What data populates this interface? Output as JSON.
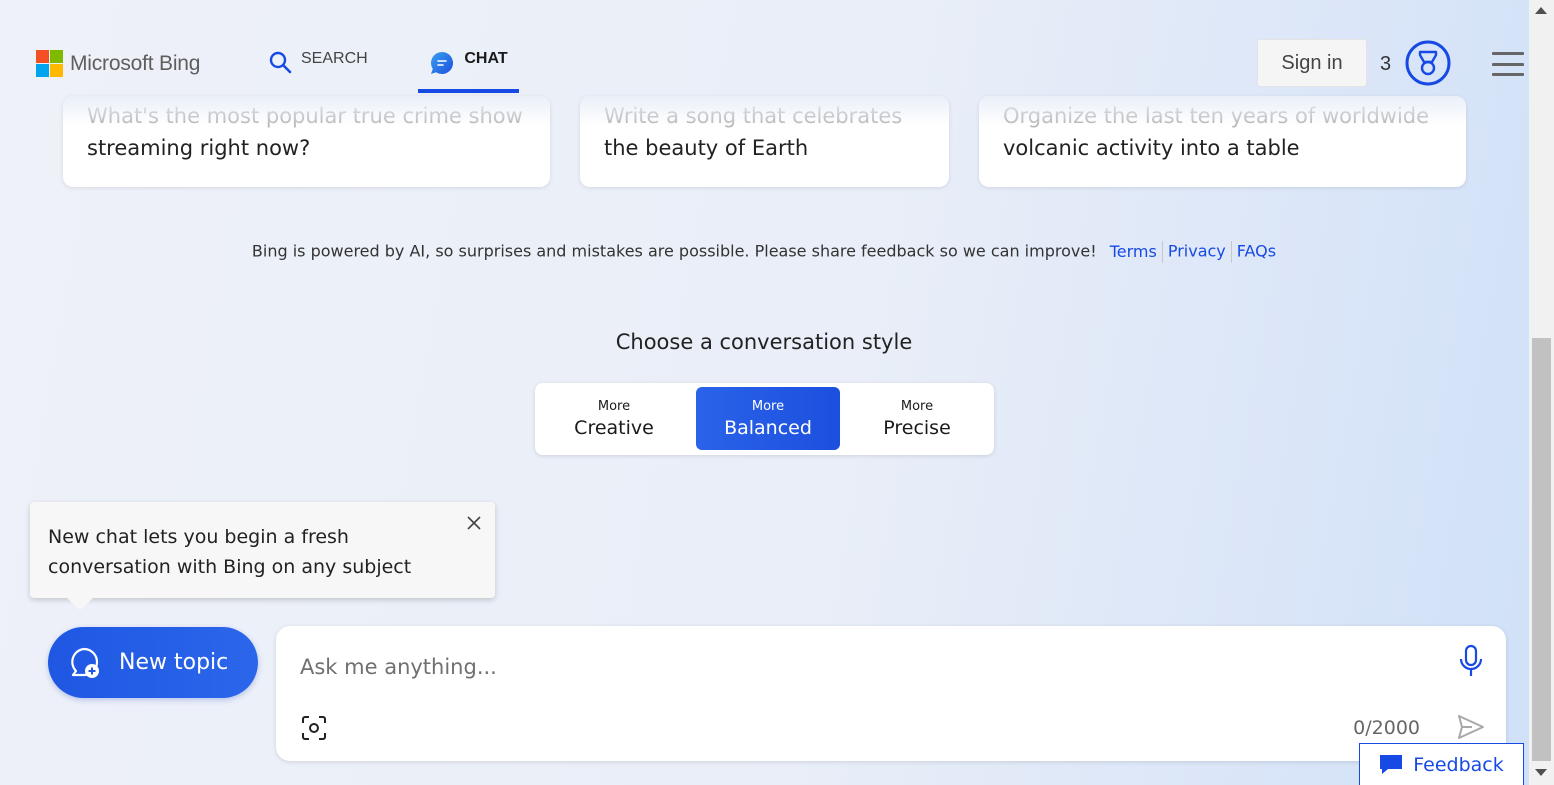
{
  "header": {
    "logo_text": "Microsoft Bing",
    "nav_search": "SEARCH",
    "nav_chat": "CHAT",
    "sign_in": "Sign in",
    "reward_count": "3",
    "accent_color": "#174ae4"
  },
  "suggestions": [
    {
      "line1": "What's the most popular true crime show",
      "line2": "streaming right now?"
    },
    {
      "line1": "Write a song that celebrates",
      "line2": "the beauty of Earth"
    },
    {
      "line1": "Organize the last ten years of worldwide",
      "line2": "volcanic activity into a table"
    }
  ],
  "disclaimer": {
    "text": "Bing is powered by AI, so surprises and mistakes are possible. Please share feedback so we can improve!",
    "links": [
      "Terms",
      "Privacy",
      "FAQs"
    ]
  },
  "conversation_style": {
    "title": "Choose a conversation style",
    "options": [
      {
        "small": "More",
        "big": "Creative",
        "selected": false
      },
      {
        "small": "More",
        "big": "Balanced",
        "selected": true
      },
      {
        "small": "More",
        "big": "Precise",
        "selected": false
      }
    ]
  },
  "tooltip": {
    "text": "New chat lets you begin a fresh conversation with Bing on any subject"
  },
  "new_topic": {
    "label": "New topic"
  },
  "input": {
    "placeholder": "Ask me anything...",
    "value": "",
    "char_count": "0/2000"
  },
  "feedback": {
    "label": "Feedback"
  },
  "icons": [
    "search-icon",
    "chat-icon",
    "reward-icon",
    "menu-icon",
    "close-icon",
    "new-topic-icon",
    "microphone-icon",
    "visual-search-icon",
    "send-icon",
    "feedback-icon"
  ]
}
